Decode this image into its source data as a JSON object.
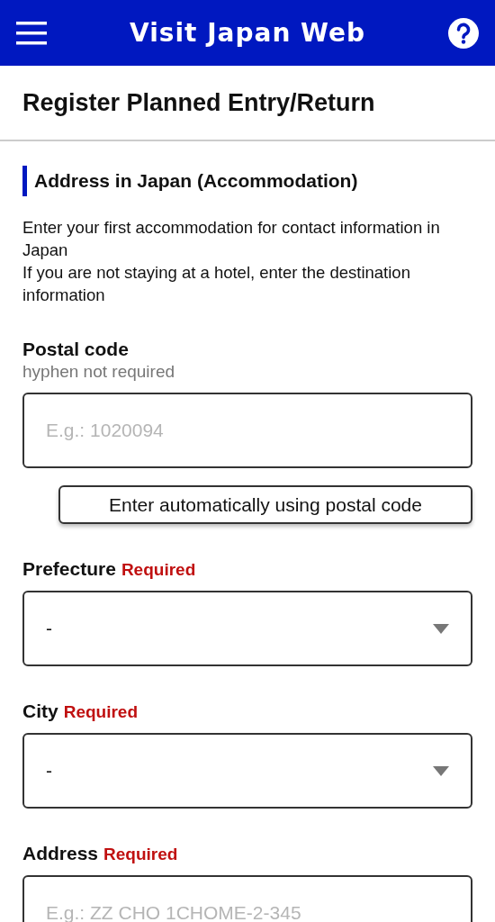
{
  "header": {
    "title": "Visit Japan Web"
  },
  "page_title": "Register Planned Entry/Return",
  "section": {
    "heading": "Address in Japan (Accommodation)",
    "description": [
      "Enter your first accommodation for contact information in Japan",
      "If you are not staying at a hotel, enter the destination information"
    ]
  },
  "fields": [
    {
      "kind": "text",
      "label": "Postal code",
      "hint": "hyphen not required",
      "placeholder": "E.g.: 1020094",
      "button": "Enter automatically using postal code"
    },
    {
      "kind": "select",
      "label": "Prefecture",
      "required": "Required",
      "value": "-"
    },
    {
      "kind": "select",
      "label": "City",
      "required": "Required",
      "value": "-"
    },
    {
      "kind": "text",
      "label": "Address",
      "required": "Required",
      "placeholder": "E.g.: ZZ CHO 1CHOME-2-345"
    }
  ]
}
